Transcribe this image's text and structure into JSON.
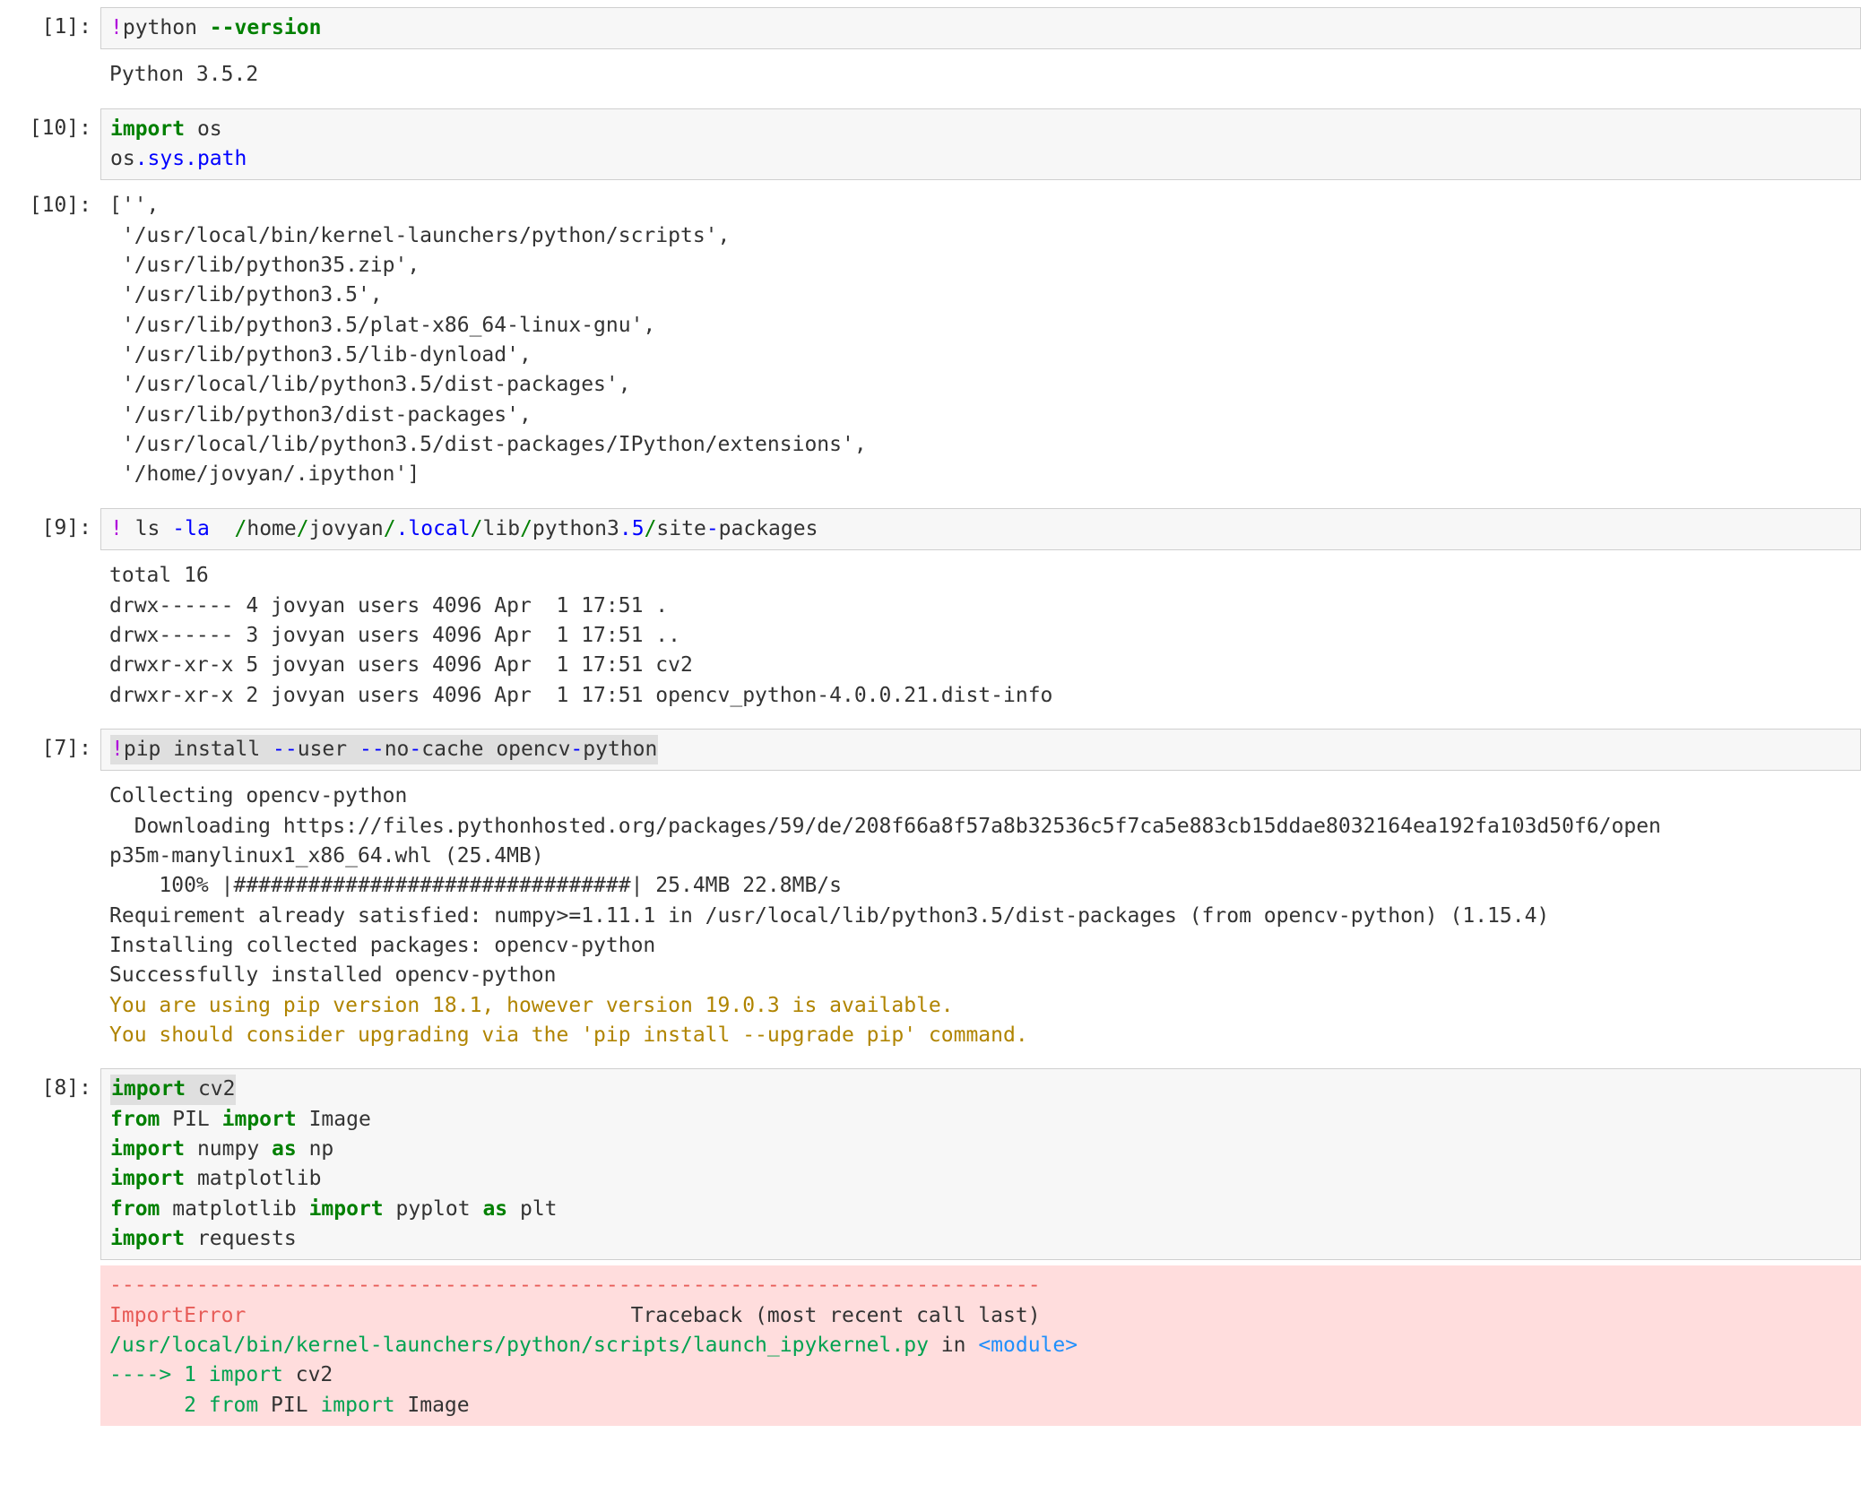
{
  "cells": [
    {
      "prompt": "[1]:",
      "type": "code",
      "code_html": "<span class='c-bang'>!</span>python <span class='c-green'>--version</span>"
    },
    {
      "prompt": "",
      "type": "output",
      "text": "Python 3.5.2"
    },
    {
      "prompt": "[10]:",
      "type": "code",
      "code_html": "<span class='c-green'>import</span> os\nos<span class='c-blue'>.sys</span><span class='c-blue'>.path</span>"
    },
    {
      "prompt": "[10]:",
      "type": "output",
      "text": "['',\n '/usr/local/bin/kernel-launchers/python/scripts',\n '/usr/lib/python35.zip',\n '/usr/lib/python3.5',\n '/usr/lib/python3.5/plat-x86_64-linux-gnu',\n '/usr/lib/python3.5/lib-dynload',\n '/usr/local/lib/python3.5/dist-packages',\n '/usr/lib/python3/dist-packages',\n '/usr/local/lib/python3.5/dist-packages/IPython/extensions',\n '/home/jovyan/.ipython']"
    },
    {
      "prompt": "[9]:",
      "type": "code",
      "code_html": "<span class='c-bang'>!</span> ls <span class='c-blue'>-la</span>  <span class='c-greenw'>/</span>home<span class='c-greenw'>/</span>jovyan<span class='c-greenw'>/</span><span class='c-blue'>.local</span><span class='c-greenw'>/</span>lib<span class='c-greenw'>/</span>python3<span class='c-blue'>.5</span><span class='c-greenw'>/</span>site<span class='c-blue'>-</span>packages"
    },
    {
      "prompt": "",
      "type": "output",
      "text": "total 16\ndrwx------ 4 jovyan users 4096 Apr  1 17:51 .\ndrwx------ 3 jovyan users 4096 Apr  1 17:51 ..\ndrwxr-xr-x 5 jovyan users 4096 Apr  1 17:51 cv2\ndrwxr-xr-x 2 jovyan users 4096 Apr  1 17:51 opencv_python-4.0.0.21.dist-info"
    },
    {
      "prompt": "[7]:",
      "type": "code",
      "code_html": "<span class='highlight-head'><span class='c-bang'>!</span>pip install <span class='c-blue'>--</span>user <span class='c-blue'>--</span>no<span class='c-blue'>-</span>cache opencv<span class='c-blue'>-</span>python</span>"
    },
    {
      "prompt": "",
      "type": "output-html",
      "html": "Collecting opencv-python\n  Downloading https://files.pythonhosted.org/packages/59/de/208f66a8f57a8b32536c5f7ca5e883cb15ddae8032164ea192fa103d50f6/open\np35m-manylinux1_x86_64.whl (25.4MB)\n    100% |################################| 25.4MB 22.8MB/s \nRequirement already satisfied: numpy&gt;=1.11.1 in /usr/local/lib/python3.5/dist-packages (from opencv-python) (1.15.4)\nInstalling collected packages: opencv-python\nSuccessfully installed opencv-python\n<span class='warn'>You are using pip version 18.1, however version 19.0.3 is available.\nYou should consider upgrading via the 'pip install --upgrade pip' command.</span>"
    },
    {
      "prompt": "[8]:",
      "type": "code",
      "code_html": "<span class='highlight-head'><span class='c-green'>import</span> cv2</span>\n<span class='c-green'>from</span> PIL <span class='c-green'>import</span> Image\n<span class='c-green'>import</span> numpy <span class='c-green'>as</span> np\n<span class='c-green'>import</span> matplotlib\n<span class='c-green'>from</span> matplotlib <span class='c-green'>import</span> pyplot <span class='c-green'>as</span> plt\n<span class='c-green'>import</span> requests"
    },
    {
      "prompt": "",
      "type": "error-html",
      "html": "<span class='tr-redsep'>---------------------------------------------------------------------------</span>\n<span class='tr-red'>ImportError</span>                               Traceback (most recent call last)\n<span class='tr-green'>/usr/local/bin/kernel-launchers/python/scripts/launch_ipykernel.py</span> in <span class='tr-cyan'>&lt;module&gt;</span>\n<span class='tr-green'>----&gt; 1</span> <span class='tr-green'>import</span> cv2\n      <span class='tr-green'>2</span> <span class='tr-green'>from</span> PIL <span class='tr-green'>import</span> Image"
    }
  ]
}
